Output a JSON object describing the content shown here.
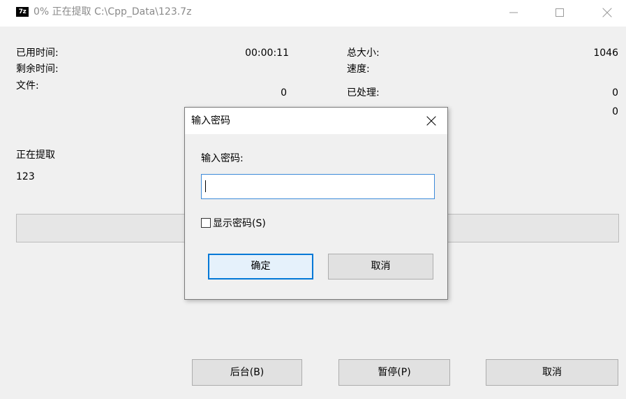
{
  "window": {
    "title": "0% 正在提取 C:\\Cpp_Data\\123.7z",
    "icon_text": "7z"
  },
  "info": {
    "elapsed_label": "已用时间:",
    "elapsed_value": "00:00:11",
    "remaining_label": "剩余时间:",
    "remaining_value": "",
    "files_label": "文件:",
    "files_value": "0",
    "total_size_label": "总大小:",
    "total_size_value": "1046",
    "speed_label": "速度:",
    "speed_value": "",
    "processed_label": "已处理:",
    "processed_value": "0",
    "compressed_value": "0"
  },
  "status": {
    "action": "正在提取",
    "item": "123"
  },
  "progress": {
    "percent": 0
  },
  "buttons": {
    "background": "后台(B)",
    "pause": "暂停(P)",
    "cancel": "取消"
  },
  "dialog": {
    "title": "输入密码",
    "prompt": "输入密码:",
    "password_value": "",
    "show_password_label": "显示密码(S)",
    "show_password_checked": false,
    "ok": "确定",
    "cancel": "取消"
  },
  "colors": {
    "accent": "#0078d7",
    "title_inactive": "#8a8a8a",
    "progress_fill": "#06b025"
  }
}
